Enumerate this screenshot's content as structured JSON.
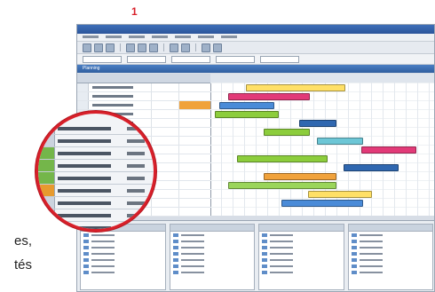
{
  "figure": {
    "number": "1"
  },
  "caption": {
    "lines": [
      "es,",
      "tés"
    ]
  },
  "window": {
    "panel_title": "Planning",
    "toolbar": {
      "buttons": [
        "new-icon",
        "open-icon",
        "save-icon",
        "cut-icon",
        "copy-icon",
        "paste-icon",
        "undo-icon",
        "redo-icon",
        "print-icon",
        "zoom-icon"
      ]
    }
  },
  "colors": {
    "accent_red": "#d8202a",
    "gantt_bar_colors": [
      "#4a8bd8",
      "#e23a78",
      "#8ccd3c",
      "#f0a23c",
      "#ffe066",
      "#6cc6d6",
      "#2f67b0",
      "#9ad55a"
    ]
  }
}
